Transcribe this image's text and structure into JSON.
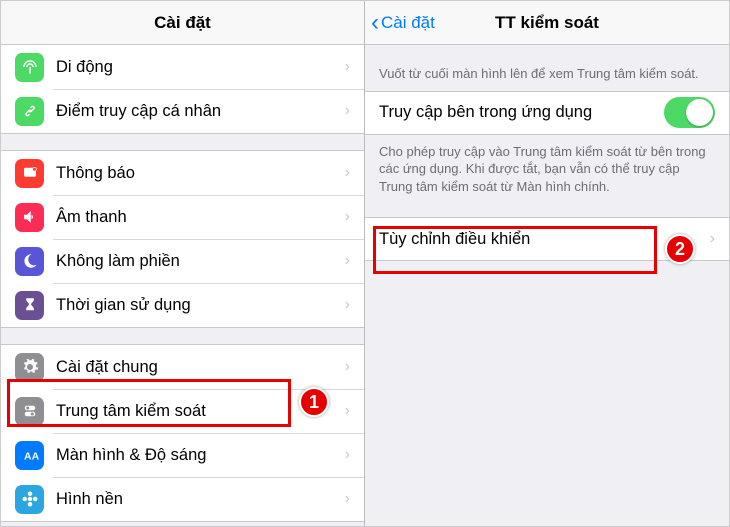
{
  "left": {
    "title": "Cài đặt",
    "groups": [
      [
        {
          "label": "Di động",
          "icon": "antenna-icon",
          "color": "ic-green"
        },
        {
          "label": "Điểm truy cập cá nhân",
          "icon": "link-icon",
          "color": "ic-green"
        }
      ],
      [
        {
          "label": "Thông báo",
          "icon": "notify-icon",
          "color": "ic-red"
        },
        {
          "label": "Âm thanh",
          "icon": "sound-icon",
          "color": "ic-pink"
        },
        {
          "label": "Không làm phiền",
          "icon": "moon-icon",
          "color": "ic-purple"
        },
        {
          "label": "Thời gian sử dụng",
          "icon": "hourglass-icon",
          "color": "ic-plum"
        }
      ],
      [
        {
          "label": "Cài đặt chung",
          "icon": "gear-icon",
          "color": "ic-gray"
        },
        {
          "label": "Trung tâm kiểm soát",
          "icon": "control-icon",
          "color": "ic-gray"
        },
        {
          "label": "Màn hình & Độ sáng",
          "icon": "text-icon",
          "color": "ic-blue"
        },
        {
          "label": "Hình nền",
          "icon": "flower-icon",
          "color": "ic-blue2"
        }
      ]
    ]
  },
  "right": {
    "back_label": "Cài đặt",
    "title": "TT kiểm soát",
    "note_top": "Vuốt từ cuối màn hình lên để xem Trung tâm kiểm soát.",
    "toggle_label": "Truy cập bên trong ứng dụng",
    "toggle_on": true,
    "note_toggle": "Cho phép truy cập vào Trung tâm kiểm soát từ bên trong các ứng dụng. Khi được tắt, bạn vẫn có thể truy cập Trung tâm kiểm soát từ Màn hình chính.",
    "customize_label": "Tùy chỉnh điều khiển"
  },
  "annotations": {
    "badge1": "1",
    "badge2": "2"
  }
}
